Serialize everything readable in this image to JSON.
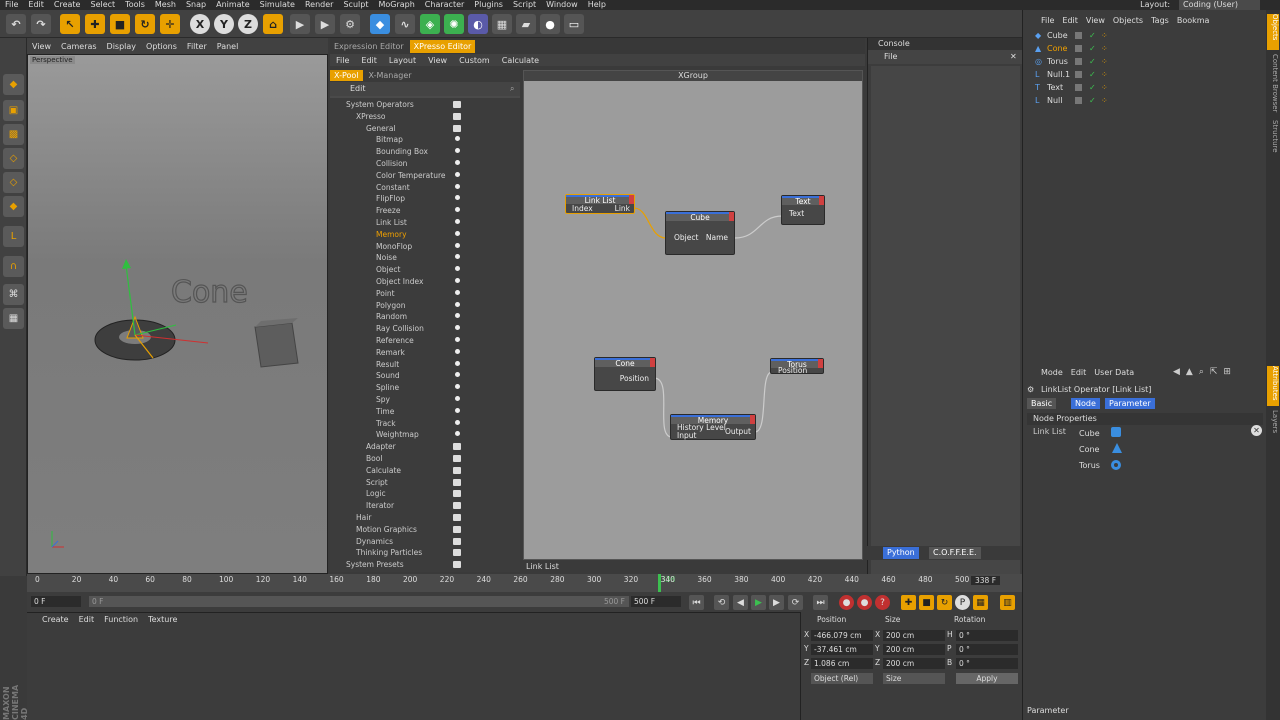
{
  "menu": {
    "items": [
      "File",
      "Edit",
      "Create",
      "Select",
      "Tools",
      "Mesh",
      "Snap",
      "Animate",
      "Simulate",
      "Render",
      "Sculpt",
      "MoGraph",
      "Character",
      "Plugins",
      "Script",
      "Window",
      "Help"
    ],
    "layout_label": "Layout:",
    "layout_value": "Coding (User)"
  },
  "toolbar": {
    "axis_x": "X",
    "axis_y": "Y",
    "axis_z": "Z"
  },
  "viewport": {
    "menu": [
      "View",
      "Cameras",
      "Display",
      "Options",
      "Filter",
      "Panel"
    ],
    "label": "Perspective",
    "scene_text": "Cone"
  },
  "editor_tabs": {
    "expression": "Expression Editor",
    "xpresso": "XPresso Editor"
  },
  "xpresso_menu": [
    "File",
    "Edit",
    "Layout",
    "View",
    "Custom",
    "Calculate"
  ],
  "xpool": {
    "tab_pool": "X-Pool",
    "tab_manager": "X-Manager",
    "edit": "Edit",
    "tree": [
      {
        "label": "System Operators",
        "level": 0
      },
      {
        "label": "XPresso",
        "level": 1
      },
      {
        "label": "General",
        "level": 2
      },
      {
        "label": "Bitmap",
        "level": 3
      },
      {
        "label": "Bounding Box",
        "level": 3
      },
      {
        "label": "Collision",
        "level": 3
      },
      {
        "label": "Color Temperature",
        "level": 3
      },
      {
        "label": "Constant",
        "level": 3
      },
      {
        "label": "FlipFlop",
        "level": 3
      },
      {
        "label": "Freeze",
        "level": 3
      },
      {
        "label": "Link List",
        "level": 3
      },
      {
        "label": "Memory",
        "level": 3
      },
      {
        "label": "MonoFlop",
        "level": 3
      },
      {
        "label": "Noise",
        "level": 3
      },
      {
        "label": "Object",
        "level": 3
      },
      {
        "label": "Object Index",
        "level": 3
      },
      {
        "label": "Point",
        "level": 3
      },
      {
        "label": "Polygon",
        "level": 3
      },
      {
        "label": "Random",
        "level": 3
      },
      {
        "label": "Ray Collision",
        "level": 3
      },
      {
        "label": "Reference",
        "level": 3
      },
      {
        "label": "Remark",
        "level": 3
      },
      {
        "label": "Result",
        "level": 3
      },
      {
        "label": "Sound",
        "level": 3
      },
      {
        "label": "Spline",
        "level": 3
      },
      {
        "label": "Spy",
        "level": 3
      },
      {
        "label": "Time",
        "level": 3
      },
      {
        "label": "Track",
        "level": 3
      },
      {
        "label": "Weightmap",
        "level": 3
      },
      {
        "label": "Adapter",
        "level": 2
      },
      {
        "label": "Bool",
        "level": 2
      },
      {
        "label": "Calculate",
        "level": 2
      },
      {
        "label": "Script",
        "level": 2
      },
      {
        "label": "Logic",
        "level": 2
      },
      {
        "label": "Iterator",
        "level": 2
      },
      {
        "label": "Hair",
        "level": 1
      },
      {
        "label": "Motion Graphics",
        "level": 1
      },
      {
        "label": "Dynamics",
        "level": 1
      },
      {
        "label": "Thinking Particles",
        "level": 1
      },
      {
        "label": "System Presets",
        "level": 0
      }
    ]
  },
  "xgroup": {
    "title": "XGroup",
    "status": "Link List",
    "nodes": {
      "linklist": {
        "title": "Link List",
        "in": "Index",
        "out": "Link"
      },
      "cube": {
        "title": "Cube",
        "in": "Object",
        "out": "Name"
      },
      "text": {
        "title": "Text",
        "in": "Text"
      },
      "cone": {
        "title": "Cone",
        "out": "Position"
      },
      "memory": {
        "title": "Memory",
        "in1": "History Level",
        "in2": "Input",
        "out": "Output"
      },
      "torus": {
        "title": "Torus",
        "in": "Position"
      }
    }
  },
  "console": {
    "title": "Console",
    "file": "File",
    "tab_python": "Python",
    "tab_coffee": "C.O.F.F.E.E."
  },
  "objects": {
    "menu": [
      "File",
      "Edit",
      "View",
      "Objects",
      "Tags",
      "Bookma"
    ],
    "rows": [
      {
        "name": "Cube",
        "highlight": false
      },
      {
        "name": "Cone",
        "highlight": true
      },
      {
        "name": "Torus",
        "highlight": false
      },
      {
        "name": "Null.1",
        "highlight": false
      },
      {
        "name": "Text",
        "highlight": false
      },
      {
        "name": "Null",
        "highlight": false
      }
    ]
  },
  "side_tabs": [
    "Objects",
    "Content Browser",
    "Structure"
  ],
  "attr_side_tabs": [
    "Attributes",
    "Layers"
  ],
  "attributes": {
    "menu": [
      "Mode",
      "Edit",
      "User Data"
    ],
    "title": "LinkList Operator [Link List]",
    "btn_basic": "Basic",
    "btn_node": "Node",
    "btn_parameter": "Parameter",
    "section": "Node Properties",
    "link_list_label": "Link List",
    "links": [
      "Cube",
      "Cone",
      "Torus"
    ],
    "footer": "Parameter"
  },
  "timeline": {
    "ticks": [
      "0",
      "20",
      "40",
      "60",
      "80",
      "100",
      "120",
      "140",
      "160",
      "180",
      "200",
      "220",
      "240",
      "260",
      "280",
      "300",
      "320",
      "340",
      "360",
      "380",
      "400",
      "420",
      "440",
      "460",
      "480",
      "500"
    ],
    "current_frame": "338",
    "frame_readout": "338 F"
  },
  "transport": {
    "start": "0 F",
    "range_start": "0 F",
    "range_end": "500 F",
    "end": "500 F"
  },
  "material": {
    "menu": [
      "Create",
      "Edit",
      "Function",
      "Texture"
    ]
  },
  "coordinates": {
    "hdr_position": "Position",
    "hdr_size": "Size",
    "hdr_rotation": "Rotation",
    "rows": [
      {
        "axis": "X",
        "pos": "-466.079 cm",
        "sax": "X",
        "size": "200 cm",
        "rax": "H",
        "rot": "0 °"
      },
      {
        "axis": "Y",
        "pos": "-37.461 cm",
        "sax": "Y",
        "size": "200 cm",
        "rax": "P",
        "rot": "0 °"
      },
      {
        "axis": "Z",
        "pos": "1.086 cm",
        "sax": "Z",
        "size": "200 cm",
        "rax": "B",
        "rot": "0 °"
      }
    ],
    "mode": "Object (Rel)",
    "size_mode": "Size",
    "apply": "Apply"
  },
  "brand": "MAXON CINEMA 4D"
}
